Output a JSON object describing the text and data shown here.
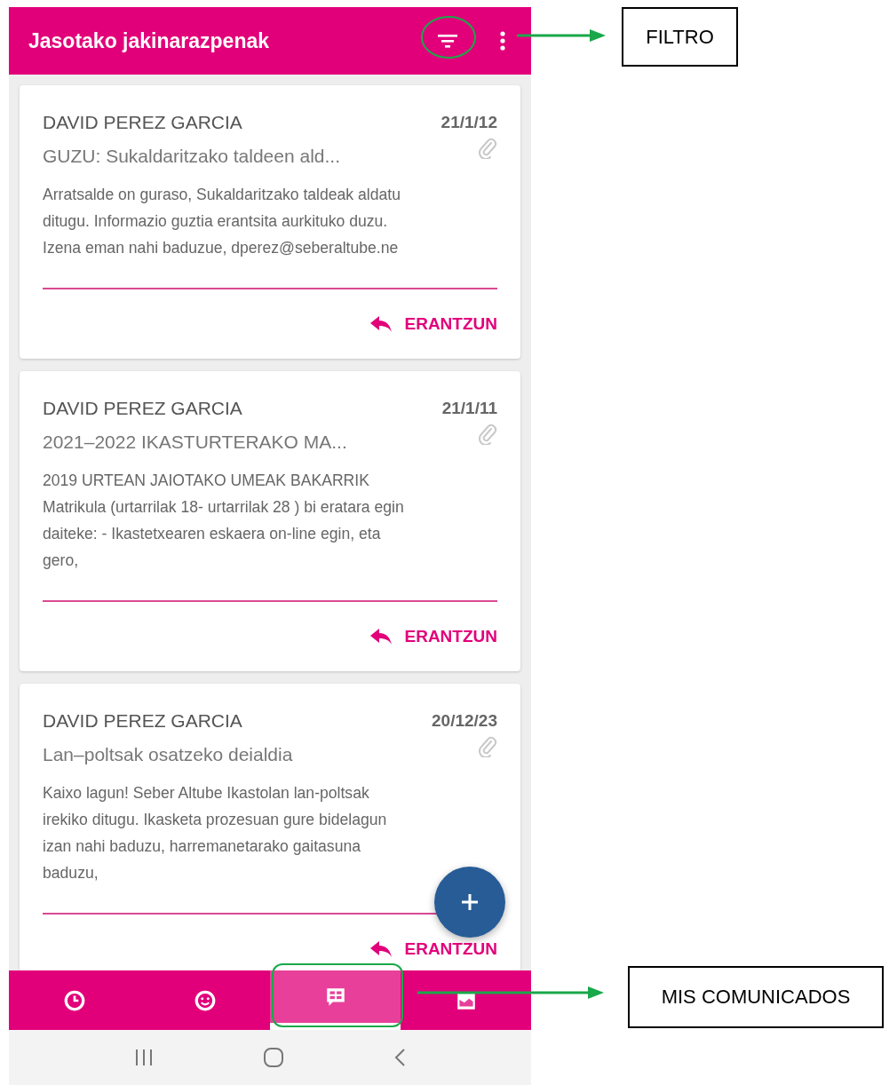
{
  "app_bar": {
    "title": "Jasotako jakinarazpenak"
  },
  "messages": [
    {
      "sender": "DAVID PEREZ GARCIA",
      "date": "21/1/12",
      "subject": "GUZU: Sukaldaritzako taldeen ald...",
      "has_attachment": true,
      "body_lines": [
        "Arratsalde on guraso, Sukaldaritzako taldeak aldatu",
        "ditugu. Informazio guztia erantsita aurkituko duzu.",
        "Izena eman nahi baduzue, dperez@seberaltube.ne"
      ],
      "reply_label": "ERANTZUN"
    },
    {
      "sender": "DAVID PEREZ GARCIA",
      "date": "21/1/11",
      "subject": "2021–2022 IKASTURTERAKO MA...",
      "has_attachment": true,
      "body_lines": [
        "2019 URTEAN JAIOTAKO UMEAK BAKARRIK",
        "Matrikula (urtarrilak 18- urtarrilak 28 ) bi eratara egin",
        "daiteke: - Ikastetxearen eskaera on-line egin, eta",
        "gero,"
      ],
      "reply_label": "ERANTZUN"
    },
    {
      "sender": "DAVID PEREZ GARCIA",
      "date": "20/12/23",
      "subject": "Lan–poltsak osatzeko deialdia",
      "has_attachment": true,
      "body_lines": [
        "Kaixo lagun! Seber Altube Ikastolan lan-poltsak",
        "irekiko ditugu. Ikasketa prozesuan gure bidelagun",
        "izan nahi baduzu, harremanetarako gaitasuna",
        "baduzu,"
      ],
      "reply_label": "ERANTZUN"
    }
  ],
  "bottom_nav": {
    "tabs": [
      {
        "kind": "clock",
        "selected": false
      },
      {
        "kind": "smiley",
        "selected": false
      },
      {
        "kind": "message",
        "selected": true
      },
      {
        "kind": "image",
        "selected": false
      }
    ]
  },
  "annotations": [
    {
      "kind": "filter",
      "label": "FILTRO"
    },
    {
      "kind": "tab",
      "label": "MIS COMUNICADOS"
    }
  ]
}
